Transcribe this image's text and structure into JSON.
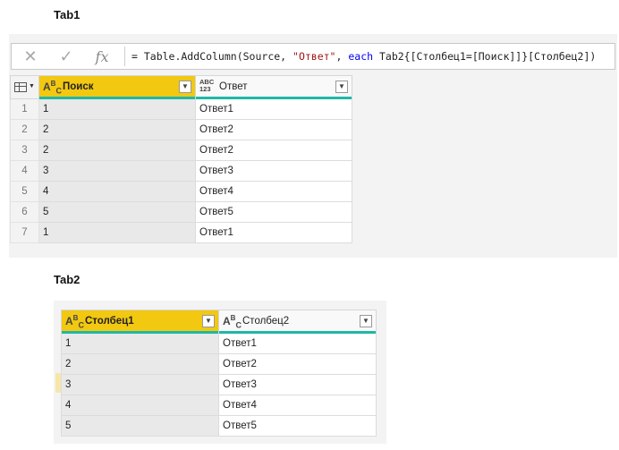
{
  "labels": {
    "tab1": "Tab1",
    "tab2": "Tab2"
  },
  "formula_bar": {
    "cancel_icon": "close-icon",
    "confirm_icon": "check-icon",
    "fx": "fx",
    "parts": {
      "p1": "= Table.AddColumn(Source, ",
      "p2": "\"Ответ\"",
      "p3": ", ",
      "p4": "each",
      "p5": " Tab2{[Столбец1=[Поиск]]}[Столбец2])"
    }
  },
  "tab1": {
    "columns": [
      {
        "type": "ABC",
        "name": "Поиск"
      },
      {
        "type": "ABC123",
        "name": "Ответ"
      }
    ],
    "rows": [
      {
        "n": "1",
        "a": "1",
        "b": "Ответ1"
      },
      {
        "n": "2",
        "a": "2",
        "b": "Ответ2"
      },
      {
        "n": "3",
        "a": "2",
        "b": "Ответ2"
      },
      {
        "n": "4",
        "a": "3",
        "b": "Ответ3"
      },
      {
        "n": "5",
        "a": "4",
        "b": "Ответ4"
      },
      {
        "n": "6",
        "a": "5",
        "b": "Ответ5"
      },
      {
        "n": "7",
        "a": "1",
        "b": "Ответ1"
      }
    ]
  },
  "tab2": {
    "columns": [
      {
        "type": "ABC",
        "name": "Столбец1"
      },
      {
        "type": "ABC",
        "name": "Столбец2"
      }
    ],
    "rows": [
      {
        "a": "1",
        "b": "Ответ1"
      },
      {
        "a": "2",
        "b": "Ответ2"
      },
      {
        "a": "3",
        "b": "Ответ3"
      },
      {
        "a": "4",
        "b": "Ответ4"
      },
      {
        "a": "5",
        "b": "Ответ5"
      }
    ]
  },
  "colors": {
    "selected_header": "#f2c811",
    "quality_bar": "#1fb8a6",
    "string": "#a31515",
    "keyword": "#0000ff"
  }
}
